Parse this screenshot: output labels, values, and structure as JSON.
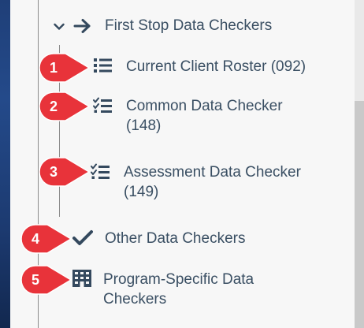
{
  "nav": {
    "group": {
      "label": "First Stop Data Checkers",
      "expanded": true,
      "children": [
        {
          "label": "Current Client Roster (092)",
          "icon": "list-bullets-icon",
          "callout": "1"
        },
        {
          "label": "Common Data Checker (148)",
          "icon": "checklist-icon",
          "callout": "2"
        },
        {
          "label": "Assessment Data Checker (149)",
          "icon": "checklist-icon",
          "callout": "3"
        }
      ]
    },
    "items": [
      {
        "label": "Other Data Checkers",
        "icon": "checkmark-icon",
        "callout": "4"
      },
      {
        "label": "Program-Specific Data Checkers",
        "icon": "building-icon",
        "callout": "5"
      }
    ]
  },
  "colors": {
    "callout": "#e8333a",
    "text": "#3a4f63",
    "icon": "#34495e",
    "sidebar_edge": "#1f3f78"
  }
}
